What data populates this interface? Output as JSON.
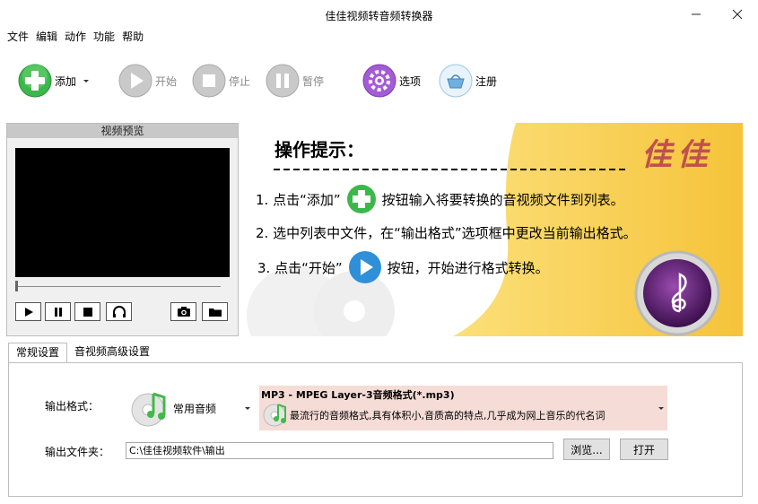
{
  "window": {
    "title": "佳佳视频转音频转换器"
  },
  "menu": [
    "文件",
    "编辑",
    "动作",
    "功能",
    "帮助"
  ],
  "toolbar": {
    "add": "添加",
    "start": "开始",
    "stop": "停止",
    "pause": "暂停",
    "options": "选项",
    "register": "注册"
  },
  "preview": {
    "title": "视频预览"
  },
  "banner": {
    "heading": "操作提示：",
    "step1_a": "1. 点击“添加”",
    "step1_b": "按钮输入将要转换的音视频文件到列表。",
    "step2": "2. 选中列表中文件，在“输出格式”选项框中更改当前输出格式。",
    "step3_a": "3. 点击“开始”",
    "step3_b": "按钮，开始进行格式转换。",
    "brand": "佳佳"
  },
  "tabs": [
    "常规设置",
    "音视频高级设置"
  ],
  "settings": {
    "format_label": "输出格式：",
    "category": "常用音频",
    "format_title": "MP3 - MPEG Layer-3音频格式(*.mp3)",
    "format_desc": "最流行的音频格式,具有体积小,音质高的特点,几乎成为网上音乐的代名词",
    "folder_label": "输出文件夹：",
    "folder_value": "C:\\佳佳视频软件\\输出",
    "browse": "浏览...",
    "open": "打开"
  },
  "colors": {
    "accent_green": "#3cb84a",
    "banner_yellow": "#f6c33a",
    "format_bg": "#f6dcd6"
  }
}
